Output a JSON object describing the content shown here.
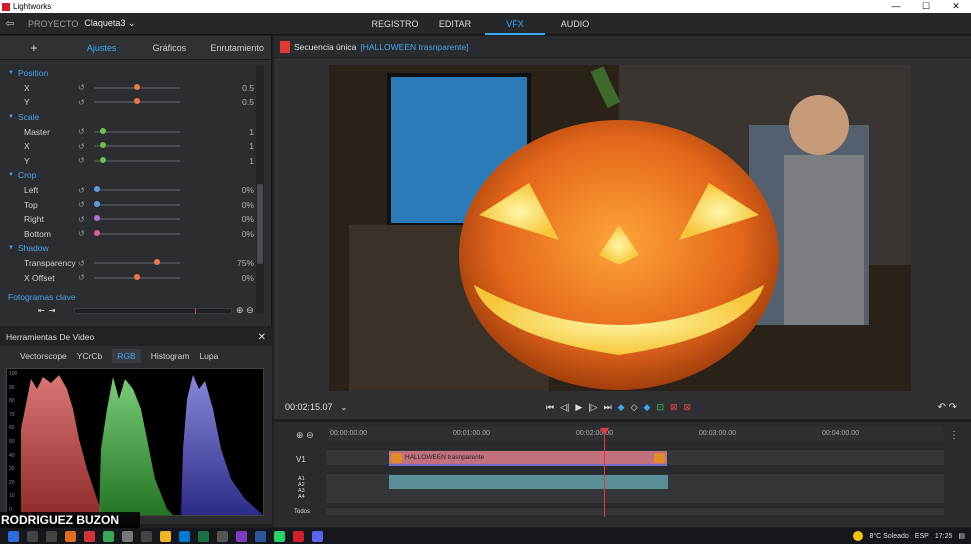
{
  "app": {
    "title": "Lightworks"
  },
  "topnav": {
    "project_label": "PROYECTO",
    "project_name": "Claqueta3 ⌄",
    "tabs": [
      {
        "label": "REGISTRO"
      },
      {
        "label": "EDITAR"
      },
      {
        "label": "VFX"
      },
      {
        "label": "AUDIO"
      }
    ],
    "active_tab": "VFX"
  },
  "left_panel": {
    "tabs": [
      {
        "label": "+"
      },
      {
        "label": "Ajustes"
      },
      {
        "label": "Gráficos"
      },
      {
        "label": "Enrutamiento"
      }
    ],
    "active_tab": "Ajustes",
    "rows": [
      {
        "kind": "section",
        "label": "Position"
      },
      {
        "kind": "param",
        "label": "X",
        "value": "0.5",
        "level": 0.5,
        "knob_color": "#e8784a"
      },
      {
        "kind": "param",
        "label": "Y",
        "value": "0.5",
        "level": 0.5,
        "knob_color": "#e8784a"
      },
      {
        "kind": "section",
        "label": "Scale"
      },
      {
        "kind": "param",
        "label": "Master",
        "value": "1",
        "level": 0.08,
        "knob_color": "#6fc04b"
      },
      {
        "kind": "param",
        "label": "X",
        "value": "1",
        "level": 0.08,
        "knob_color": "#6fc04b"
      },
      {
        "kind": "param",
        "label": "Y",
        "value": "1",
        "level": 0.08,
        "knob_color": "#6fc04b"
      },
      {
        "kind": "section",
        "label": "Crop"
      },
      {
        "kind": "param",
        "label": "Left",
        "value": "0%",
        "level": 0.0,
        "knob_color": "#5b9fe0"
      },
      {
        "kind": "param",
        "label": "Top",
        "value": "0%",
        "level": 0.0,
        "knob_color": "#5b9fe0"
      },
      {
        "kind": "param",
        "label": "Right",
        "value": "0%",
        "level": 0.0,
        "knob_color": "#b06fd6"
      },
      {
        "kind": "param",
        "label": "Bottom",
        "value": "0%",
        "level": 0.0,
        "knob_color": "#e05b9f"
      },
      {
        "kind": "section",
        "label": "Shadow"
      },
      {
        "kind": "param",
        "label": "Transparency",
        "value": "75%",
        "level": 0.75,
        "knob_color": "#e8784a"
      },
      {
        "kind": "param",
        "label": "X Offset",
        "value": "0%",
        "level": 0.5,
        "knob_color": "#e8784a"
      }
    ],
    "keyframes_label": "Fotogramas clave"
  },
  "video_tools": {
    "title": "Herramientas De Video",
    "tabs": [
      {
        "label": "Vectorscope"
      },
      {
        "label": "YCrCb"
      },
      {
        "label": "RGB"
      },
      {
        "label": "Histogram"
      },
      {
        "label": "Lupa"
      }
    ],
    "active_tab": "RGB",
    "scale": [
      "100",
      "90",
      "80",
      "70",
      "60",
      "50",
      "40",
      "30",
      "20",
      "10",
      "0"
    ],
    "colors": {
      "r": "#ff6a6a",
      "g": "#5fe05f",
      "b": "#7a7aff"
    }
  },
  "watermark": "RODRIGUEZ BUZON",
  "viewer": {
    "sequence_label": "Secuencia única",
    "clip_label": "[HALLOWEEN trasnparente]",
    "timecode": "00:02:15.07",
    "timecode_menu": "⌄"
  },
  "timeline": {
    "ruler": [
      "00:00:00.00",
      "00:01:00.00",
      "00:02:00.00",
      "00:03:00.00",
      "00:04:00.00"
    ],
    "tracks": [
      {
        "label": "V1"
      },
      {
        "label": "A1\nA2\nA3\nA4"
      },
      {
        "label": "Todos"
      }
    ],
    "clip_name": "HALLOWEEN trasnparente"
  },
  "taskbar": {
    "weather": "8°C  Soleado",
    "lang": "ESP",
    "time": "17:25"
  },
  "colors": {
    "accent": "#3aa8f0",
    "section": "#4aa3e6",
    "playhead": "#e53935"
  }
}
